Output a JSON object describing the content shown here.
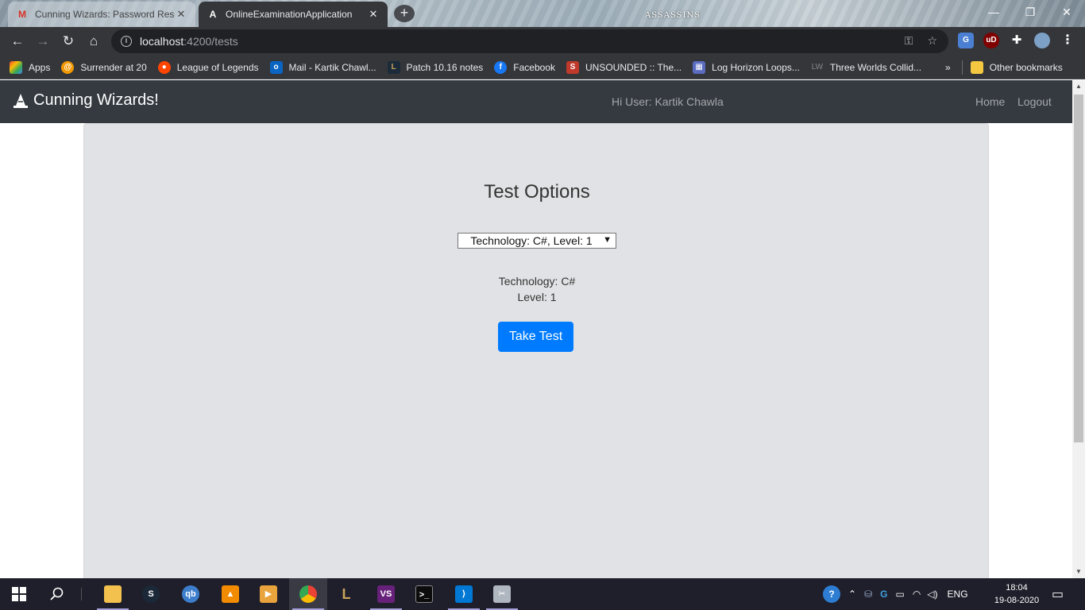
{
  "browser": {
    "tabs": [
      {
        "title": "Cunning Wizards: Password Rese",
        "icon": "gmail-icon",
        "active": false
      },
      {
        "title": "OnlineExaminationApplication",
        "icon": "angular-icon",
        "active": true
      }
    ],
    "new_tab": "+",
    "theme_logo": "ASSASSINS",
    "window_controls": {
      "minimize": "—",
      "restore": "❐",
      "close": "✕"
    },
    "url_host": "localhost",
    "url_path": ":4200/tests",
    "nav": {
      "back": "←",
      "forward": "→",
      "reload": "↻",
      "home": "⌂"
    },
    "bookmarks": [
      {
        "label": "Apps",
        "icon": "apps-grid-icon",
        "color": "#e94335"
      },
      {
        "label": "Surrender at 20",
        "icon": "surrender-icon",
        "color": "#f29900"
      },
      {
        "label": "League of Legends",
        "icon": "reddit-icon",
        "color": "#ff4500"
      },
      {
        "label": "Mail - Kartik Chawl...",
        "icon": "outlook-icon",
        "color": "#0a64c2"
      },
      {
        "label": "Patch 10.16 notes",
        "icon": "league-icon",
        "color": "#b8892e"
      },
      {
        "label": "Facebook",
        "icon": "facebook-icon",
        "color": "#1877f2"
      },
      {
        "label": "UNSOUNDED :: The...",
        "icon": "unsounded-icon",
        "color": "#c0392b"
      },
      {
        "label": "Log Horizon Loops...",
        "icon": "log-horizon-icon",
        "color": "#5b6bc0"
      },
      {
        "label": "Three Worlds Collid...",
        "icon": "lw-icon",
        "color": "#666666"
      }
    ],
    "bookmarks_overflow": "»",
    "other_bookmarks": "Other bookmarks"
  },
  "app": {
    "brand": "Cunning Wizards!",
    "greeting": "Hi User: Kartik Chawla",
    "nav_home": "Home",
    "nav_logout": "Logout",
    "heading": "Test Options",
    "select_value": "Technology: C#, Level: 1",
    "technology_line": "Technology: C#",
    "level_line": "Level: 1",
    "take_test": "Take Test",
    "accent": "#007bff",
    "navbar_color": "#343a40"
  },
  "taskbar": {
    "apps": [
      "windows-start-icon",
      "search-icon",
      "file-explorer-icon",
      "steam-icon",
      "qbittorrent-icon",
      "vlc-icon",
      "media-player-icon",
      "chrome-icon",
      "league-client-icon",
      "visual-studio-icon",
      "terminal-icon",
      "vscode-icon",
      "tools-icon"
    ],
    "language": "ENG",
    "time": "18:04",
    "date": "19-08-2020"
  }
}
